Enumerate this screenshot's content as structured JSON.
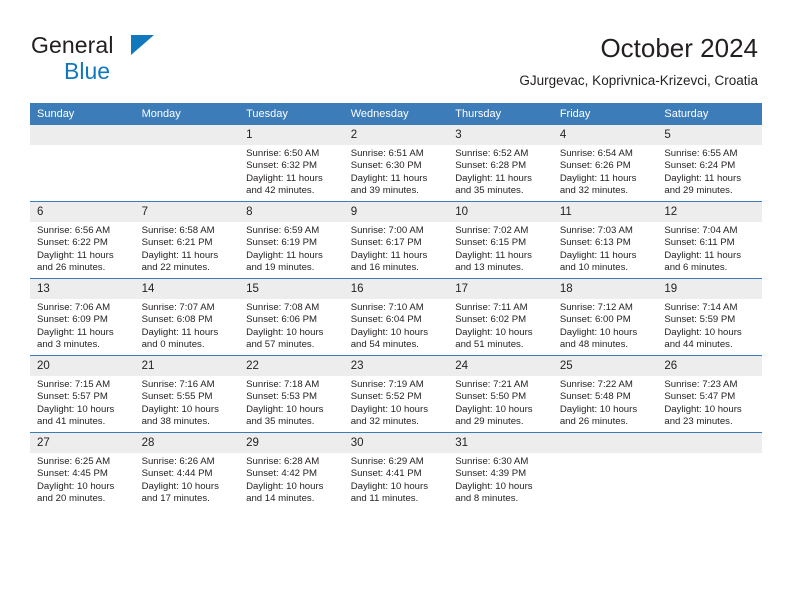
{
  "brand": {
    "name_line1": "General",
    "name_line2": "Blue",
    "triangle_icon": "triangle-icon",
    "accent_color": "#1278be"
  },
  "header": {
    "title": "October 2024",
    "subtitle": "GJurgevac, Koprivnica-Krizevci, Croatia"
  },
  "colors": {
    "header_bar": "#3c7cb9",
    "daynum_band": "#ededed",
    "text": "#231f20"
  },
  "weekday_headers": [
    "Sunday",
    "Monday",
    "Tuesday",
    "Wednesday",
    "Thursday",
    "Friday",
    "Saturday"
  ],
  "weeks": [
    [
      {
        "day": "",
        "empty": true
      },
      {
        "day": "",
        "empty": true
      },
      {
        "day": "1",
        "sunrise": "Sunrise: 6:50 AM",
        "sunset": "Sunset: 6:32 PM",
        "daylight": "Daylight: 11 hours and 42 minutes."
      },
      {
        "day": "2",
        "sunrise": "Sunrise: 6:51 AM",
        "sunset": "Sunset: 6:30 PM",
        "daylight": "Daylight: 11 hours and 39 minutes."
      },
      {
        "day": "3",
        "sunrise": "Sunrise: 6:52 AM",
        "sunset": "Sunset: 6:28 PM",
        "daylight": "Daylight: 11 hours and 35 minutes."
      },
      {
        "day": "4",
        "sunrise": "Sunrise: 6:54 AM",
        "sunset": "Sunset: 6:26 PM",
        "daylight": "Daylight: 11 hours and 32 minutes."
      },
      {
        "day": "5",
        "sunrise": "Sunrise: 6:55 AM",
        "sunset": "Sunset: 6:24 PM",
        "daylight": "Daylight: 11 hours and 29 minutes."
      }
    ],
    [
      {
        "day": "6",
        "sunrise": "Sunrise: 6:56 AM",
        "sunset": "Sunset: 6:22 PM",
        "daylight": "Daylight: 11 hours and 26 minutes."
      },
      {
        "day": "7",
        "sunrise": "Sunrise: 6:58 AM",
        "sunset": "Sunset: 6:21 PM",
        "daylight": "Daylight: 11 hours and 22 minutes."
      },
      {
        "day": "8",
        "sunrise": "Sunrise: 6:59 AM",
        "sunset": "Sunset: 6:19 PM",
        "daylight": "Daylight: 11 hours and 19 minutes."
      },
      {
        "day": "9",
        "sunrise": "Sunrise: 7:00 AM",
        "sunset": "Sunset: 6:17 PM",
        "daylight": "Daylight: 11 hours and 16 minutes."
      },
      {
        "day": "10",
        "sunrise": "Sunrise: 7:02 AM",
        "sunset": "Sunset: 6:15 PM",
        "daylight": "Daylight: 11 hours and 13 minutes."
      },
      {
        "day": "11",
        "sunrise": "Sunrise: 7:03 AM",
        "sunset": "Sunset: 6:13 PM",
        "daylight": "Daylight: 11 hours and 10 minutes."
      },
      {
        "day": "12",
        "sunrise": "Sunrise: 7:04 AM",
        "sunset": "Sunset: 6:11 PM",
        "daylight": "Daylight: 11 hours and 6 minutes."
      }
    ],
    [
      {
        "day": "13",
        "sunrise": "Sunrise: 7:06 AM",
        "sunset": "Sunset: 6:09 PM",
        "daylight": "Daylight: 11 hours and 3 minutes."
      },
      {
        "day": "14",
        "sunrise": "Sunrise: 7:07 AM",
        "sunset": "Sunset: 6:08 PM",
        "daylight": "Daylight: 11 hours and 0 minutes."
      },
      {
        "day": "15",
        "sunrise": "Sunrise: 7:08 AM",
        "sunset": "Sunset: 6:06 PM",
        "daylight": "Daylight: 10 hours and 57 minutes."
      },
      {
        "day": "16",
        "sunrise": "Sunrise: 7:10 AM",
        "sunset": "Sunset: 6:04 PM",
        "daylight": "Daylight: 10 hours and 54 minutes."
      },
      {
        "day": "17",
        "sunrise": "Sunrise: 7:11 AM",
        "sunset": "Sunset: 6:02 PM",
        "daylight": "Daylight: 10 hours and 51 minutes."
      },
      {
        "day": "18",
        "sunrise": "Sunrise: 7:12 AM",
        "sunset": "Sunset: 6:00 PM",
        "daylight": "Daylight: 10 hours and 48 minutes."
      },
      {
        "day": "19",
        "sunrise": "Sunrise: 7:14 AM",
        "sunset": "Sunset: 5:59 PM",
        "daylight": "Daylight: 10 hours and 44 minutes."
      }
    ],
    [
      {
        "day": "20",
        "sunrise": "Sunrise: 7:15 AM",
        "sunset": "Sunset: 5:57 PM",
        "daylight": "Daylight: 10 hours and 41 minutes."
      },
      {
        "day": "21",
        "sunrise": "Sunrise: 7:16 AM",
        "sunset": "Sunset: 5:55 PM",
        "daylight": "Daylight: 10 hours and 38 minutes."
      },
      {
        "day": "22",
        "sunrise": "Sunrise: 7:18 AM",
        "sunset": "Sunset: 5:53 PM",
        "daylight": "Daylight: 10 hours and 35 minutes."
      },
      {
        "day": "23",
        "sunrise": "Sunrise: 7:19 AM",
        "sunset": "Sunset: 5:52 PM",
        "daylight": "Daylight: 10 hours and 32 minutes."
      },
      {
        "day": "24",
        "sunrise": "Sunrise: 7:21 AM",
        "sunset": "Sunset: 5:50 PM",
        "daylight": "Daylight: 10 hours and 29 minutes."
      },
      {
        "day": "25",
        "sunrise": "Sunrise: 7:22 AM",
        "sunset": "Sunset: 5:48 PM",
        "daylight": "Daylight: 10 hours and 26 minutes."
      },
      {
        "day": "26",
        "sunrise": "Sunrise: 7:23 AM",
        "sunset": "Sunset: 5:47 PM",
        "daylight": "Daylight: 10 hours and 23 minutes."
      }
    ],
    [
      {
        "day": "27",
        "sunrise": "Sunrise: 6:25 AM",
        "sunset": "Sunset: 4:45 PM",
        "daylight": "Daylight: 10 hours and 20 minutes."
      },
      {
        "day": "28",
        "sunrise": "Sunrise: 6:26 AM",
        "sunset": "Sunset: 4:44 PM",
        "daylight": "Daylight: 10 hours and 17 minutes."
      },
      {
        "day": "29",
        "sunrise": "Sunrise: 6:28 AM",
        "sunset": "Sunset: 4:42 PM",
        "daylight": "Daylight: 10 hours and 14 minutes."
      },
      {
        "day": "30",
        "sunrise": "Sunrise: 6:29 AM",
        "sunset": "Sunset: 4:41 PM",
        "daylight": "Daylight: 10 hours and 11 minutes."
      },
      {
        "day": "31",
        "sunrise": "Sunrise: 6:30 AM",
        "sunset": "Sunset: 4:39 PM",
        "daylight": "Daylight: 10 hours and 8 minutes."
      },
      {
        "day": "",
        "empty": true
      },
      {
        "day": "",
        "empty": true
      }
    ]
  ]
}
